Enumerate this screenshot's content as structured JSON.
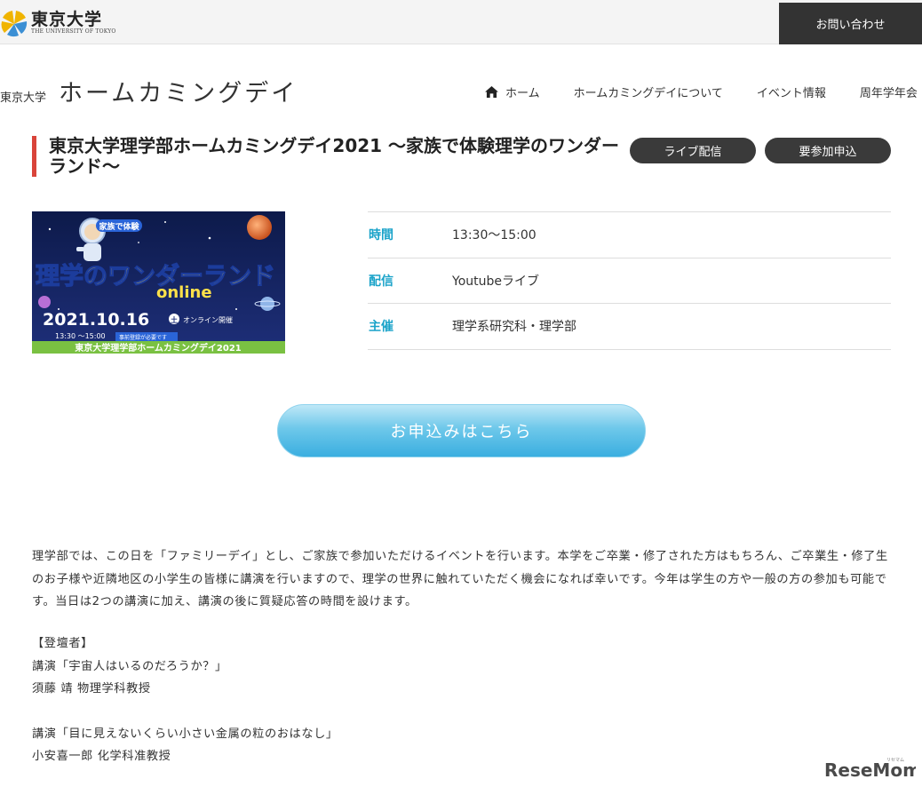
{
  "topbar": {
    "logo": {
      "name_ja": "東京大学",
      "name_en": "THE UNIVERSITY OF TOKYO",
      "icon": "ginkgo-emblem-icon"
    },
    "contact_label": "お問い合わせ"
  },
  "header": {
    "brand_small": "東京大学",
    "brand_big": "ホームカミングデイ",
    "nav": [
      {
        "label": "ホーム",
        "icon": "home-icon"
      },
      {
        "label": "ホームカミングデイについて"
      },
      {
        "label": "イベント情報"
      },
      {
        "label": "周年学年会"
      }
    ]
  },
  "event": {
    "title": "東京大学理学部ホームカミングデイ2021 〜家族で体験理学のワンダーランド〜",
    "tags": [
      "ライブ配信",
      "要参加申込"
    ],
    "banner": {
      "badge": "家族で体験",
      "headline": "理学のワンダーランド",
      "sub": "online",
      "date": "2021.10.16",
      "weekday": "土",
      "mode": "オンライン開催",
      "time": "13:30 〜15:00",
      "note": "事前登録が必要です",
      "footer": "東京大学理学部ホームカミングデイ2021"
    },
    "info": [
      {
        "label": "時間",
        "value": "13:30〜15:00"
      },
      {
        "label": "配信",
        "value": "Youtubeライブ"
      },
      {
        "label": "主催",
        "value": "理学系研究科・理学部"
      }
    ],
    "apply_label": "お申込みはこちら",
    "description": "理学部では、この日を「ファミリーデイ」とし、ご家族で参加いただけるイベントを行います。本学をご卒業・修了された方はもちろん、ご卒業生・修了生のお子様や近隣地区の小学生の皆様に講演を行いますので、理学の世界に触れていただく機会になれば幸いです。今年は学生の方や一般の方の参加も可能です。当日は2つの講演に加え、講演の後に質疑応答の時間を設けます。",
    "speakers_heading": "【登壇者】",
    "lectures": [
      {
        "title": "講演「宇宙人はいるのだろうか？」",
        "speaker": "須藤 靖 物理学科教授"
      },
      {
        "title": "講演「目に見えないくらい小さい金属の粒のおはなし」",
        "speaker": "小安喜一郎 化学科准教授"
      }
    ]
  },
  "watermark": {
    "text": "ReseMom",
    "small": "リセマム"
  },
  "colors": {
    "accent_red": "#d9443a",
    "label_blue": "#1aa3c9",
    "button_blue": "#3aaee0",
    "dark": "#333333"
  }
}
